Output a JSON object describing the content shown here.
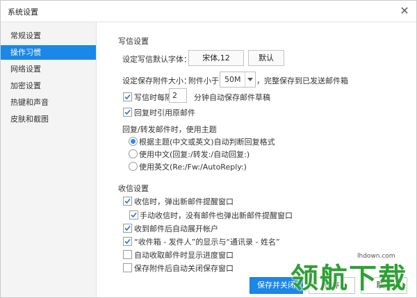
{
  "window": {
    "title": "系统设置"
  },
  "sidebar": {
    "items": [
      {
        "label": "常规设置",
        "active": false
      },
      {
        "label": "操作习惯",
        "active": true
      },
      {
        "label": "网络设置",
        "active": false
      },
      {
        "label": "加密设置",
        "active": false
      },
      {
        "label": "热键和声音",
        "active": false
      },
      {
        "label": "皮肤和截图",
        "active": false
      }
    ]
  },
  "compose": {
    "section_title": "写信设置",
    "font_label": "设定写信默认字体：",
    "font_value": "宋体,12",
    "default_button": "默认",
    "attach_label": "设定保存附件大小：",
    "attach_prefix": "附件小于",
    "attach_size": "50M",
    "attach_suffix": "，完整保存到已发送邮件箱",
    "autosave_label": "写信时每隔",
    "autosave_minutes": "2",
    "autosave_suffix": "分钟自动保存邮件草稿",
    "quote_label": "回复时引用原邮件",
    "subject_label": "回复/转发邮件时，使用主题",
    "subject_options": [
      {
        "label": "根据主题(中文或英文)自动判断回复格式",
        "selected": true
      },
      {
        "label": "使用中文(回复:/转发:/自动回复:)",
        "selected": false
      },
      {
        "label": "使用英文(Re:/Fw:/AutoReply:)",
        "selected": false
      }
    ]
  },
  "receive": {
    "section_title": "收信设置",
    "options": [
      {
        "label": "收信时，弹出新邮件提醒窗口",
        "checked": true
      },
      {
        "label": "手动收信时，没有邮件也弹出新邮件提醒窗口",
        "checked": true
      },
      {
        "label": "收到邮件后自动展开帐户",
        "checked": true
      },
      {
        "label": "“收件箱 - 发件人”的显示与“通讯录 - 姓名”",
        "checked": true
      },
      {
        "label": "自动收取邮件时显示进度窗口",
        "checked": false
      },
      {
        "label": "保存附件后自动关闭保存窗口",
        "checked": false
      }
    ]
  },
  "footer": {
    "save_close": "保存并关闭",
    "save": "保存",
    "cancel": "取消"
  },
  "watermark": {
    "text": "领航下载",
    "url": "lhdown.com"
  },
  "colors": {
    "accent": "#1b87e6",
    "watermark": "#2fa035"
  }
}
